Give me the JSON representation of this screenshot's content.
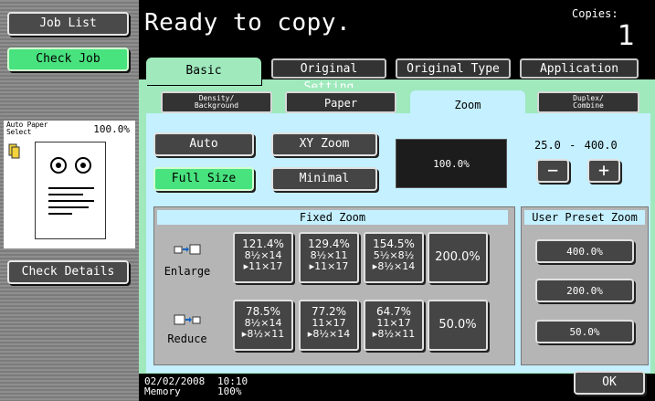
{
  "sidebar": {
    "job_list": "Job List",
    "check_job": "Check Job",
    "auto_paper": "Auto Paper Select",
    "thumb_zoom": "100.0%",
    "check_details": "Check Details"
  },
  "header": {
    "status": "Ready to copy.",
    "copies_label": "Copies:",
    "copies_value": "1"
  },
  "tabs": [
    "Basic",
    "Original Setting",
    "Original Type",
    "Application"
  ],
  "subtabs": {
    "density": "Density/\nBackground",
    "paper": "Paper",
    "zoom": "Zoom",
    "duplex": "Duplex/\nCombine"
  },
  "zoom": {
    "auto": "Auto",
    "xy_zoom": "XY Zoom",
    "full_size": "Full Size",
    "minimal": "Minimal",
    "current": "100.0%",
    "range_min": "25.0",
    "range_sep": "-",
    "range_max": "400.0",
    "minus": "−",
    "plus": "+"
  },
  "fixed_zoom": {
    "title": "Fixed Zoom",
    "enlarge_label": "Enlarge",
    "reduce_label": "Reduce",
    "enlarge": [
      {
        "pct": "121.4%",
        "line1": "8½×14",
        "line2": "▸11×17"
      },
      {
        "pct": "129.4%",
        "line1": "8½×11",
        "line2": "▸11×17"
      },
      {
        "pct": "154.5%",
        "line1": "5½×8½",
        "line2": "▸8½×14"
      }
    ],
    "enlarge_max": "200.0%",
    "reduce": [
      {
        "pct": "78.5%",
        "line1": "8½×14",
        "line2": "▸8½×11"
      },
      {
        "pct": "77.2%",
        "line1": "11×17",
        "line2": "▸8½×14"
      },
      {
        "pct": "64.7%",
        "line1": "11×17",
        "line2": "▸8½×11"
      }
    ],
    "reduce_min": "50.0%"
  },
  "user_preset": {
    "title": "User Preset Zoom",
    "values": [
      "400.0%",
      "200.0%",
      "50.0%"
    ]
  },
  "footer": {
    "date": "02/02/2008",
    "memory_label": "Memory",
    "time": "10:10",
    "memory_value": "100%",
    "ok": "OK"
  },
  "colors": {
    "accent_green": "#48e27e",
    "tab_bg": "#9fe9bd",
    "content_bg": "#c4f0ff"
  }
}
